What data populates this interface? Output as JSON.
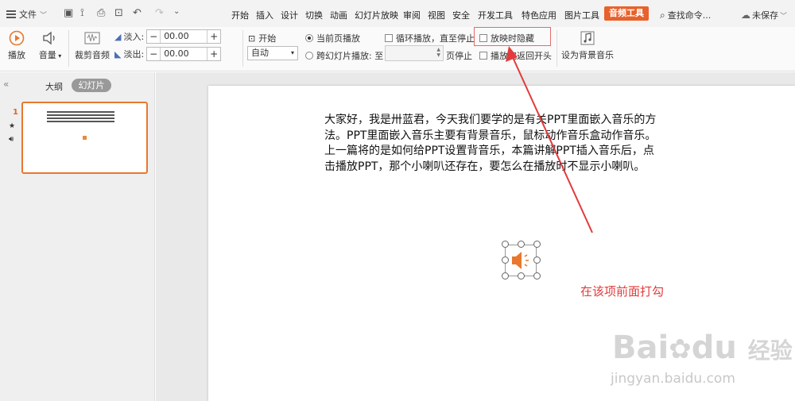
{
  "menubar": {
    "file_label": "文件",
    "tabs": [
      "开始",
      "插入",
      "设计",
      "切换",
      "动画",
      "幻灯片放映",
      "审阅",
      "视图",
      "安全",
      "开发工具",
      "特色应用",
      "图片工具"
    ],
    "active_tab": "音频工具",
    "search_label": "查找命令...",
    "save_status": "未保存"
  },
  "ribbon": {
    "play_label": "播放",
    "volume_label": "音量",
    "trim_label": "裁剪音频",
    "fade_in_label": "淡入:",
    "fade_in_value": "00.00",
    "fade_out_label": "淡出:",
    "fade_out_value": "00.00",
    "start_label": "开始",
    "start_value": "自动",
    "current_page_label": "当前页播放",
    "cross_slide_label": "跨幻灯片播放: 至",
    "page_stop_label": "页停止",
    "loop_label": "循环播放，直至停止",
    "hide_label": "放映时隐藏",
    "rewind_label": "播放完返回开头",
    "bg_music_label": "设为背景音乐"
  },
  "leftpanel": {
    "outline_tab": "大纲",
    "slides_tab": "幻灯片",
    "slide_number": "1"
  },
  "slide": {
    "lines": [
      "大家好，我是卅蓝君，今天我们要学的是有关PPT里面嵌入音乐的方",
      "法。PPT里面嵌入音乐主要有背景音乐，鼠标动作音乐盒动作音乐。",
      "上一篇将的是如何给PPT设置背音乐，本篇讲解PPT插入音乐后，点",
      "击播放PPT，那个小喇叭还存在，要怎么在播放时不显示小喇叭。"
    ]
  },
  "annotation": {
    "text": "在该项前面打勾",
    "color": "#e23b3b"
  },
  "watermark": {
    "brand": "Bai",
    "brand_suffix": "du",
    "brand_cn": "经验",
    "url": "jingyan.baidu.com"
  },
  "colors": {
    "accent": "#e8612b"
  }
}
